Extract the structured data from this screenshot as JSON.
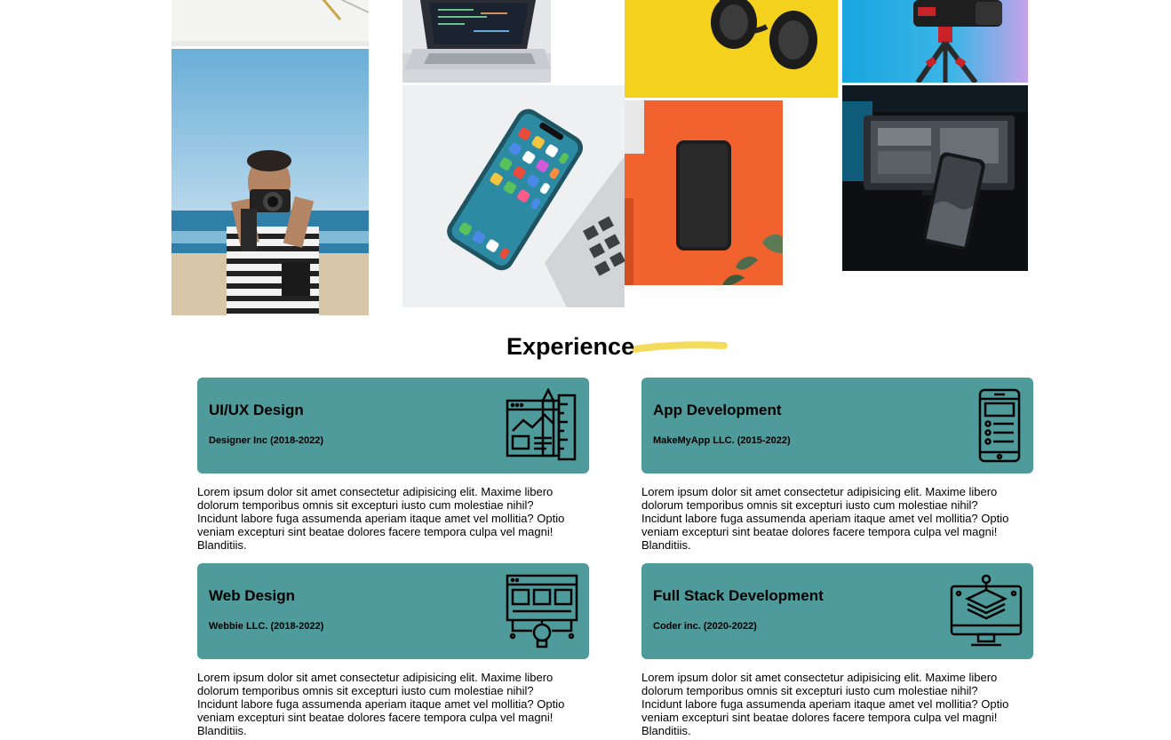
{
  "gallery": {
    "photos": [
      {
        "name": "notebook-pen-photo",
        "icon": "pen-on-paper"
      },
      {
        "name": "photographer-beach-photo",
        "icon": "person-with-camera"
      },
      {
        "name": "laptop-code-photo",
        "icon": "laptop"
      },
      {
        "name": "smartphone-on-laptop-photo",
        "icon": "smartphone"
      },
      {
        "name": "headphones-yellow-photo",
        "icon": "headphones"
      },
      {
        "name": "phone-orange-photo",
        "icon": "smartphone"
      },
      {
        "name": "camera-tripod-photo",
        "icon": "camera"
      },
      {
        "name": "phone-dark-desk-photo",
        "icon": "smartphone"
      }
    ]
  },
  "experience": {
    "title": "Experience",
    "accent_color": "#f3dc5b",
    "card_color": "#4f9a9a",
    "items": [
      {
        "title": "UI/UX Design",
        "company": "Designer Inc (2018-2022)",
        "icon": "design-tools-icon",
        "description": "Lorem ipsum dolor sit amet consectetur adipisicing elit. Maxime libero dolorum temporibus omnis sit excepturi iusto cum molestiae nihil? Incidunt labore fuga assumenda aperiam itaque amet vel mollitia? Optio veniam excepturi sint beatae dolores facere tempora culpa vel magni! Blanditiis."
      },
      {
        "title": "App Development",
        "company": "MakeMyApp LLC. (2015-2022)",
        "icon": "mobile-app-icon",
        "description": "Lorem ipsum dolor sit amet consectetur adipisicing elit. Maxime libero dolorum temporibus omnis sit excepturi iusto cum molestiae nihil? Incidunt labore fuga assumenda aperiam itaque amet vel mollitia? Optio veniam excepturi sint beatae dolores facere tempora culpa vel magni! Blanditiis."
      },
      {
        "title": "Web Design",
        "company": "Webbie LLC. (2018-2022)",
        "icon": "web-design-icon",
        "description": "Lorem ipsum dolor sit amet consectetur adipisicing elit. Maxime libero dolorum temporibus omnis sit excepturi iusto cum molestiae nihil? Incidunt labore fuga assumenda aperiam itaque amet vel mollitia? Optio veniam excepturi sint beatae dolores facere tempora culpa vel magni! Blanditiis."
      },
      {
        "title": "Full Stack Development",
        "company": "Coder inc. (2020-2022)",
        "icon": "full-stack-icon",
        "description": "Lorem ipsum dolor sit amet consectetur adipisicing elit. Maxime libero dolorum temporibus omnis sit excepturi iusto cum molestiae nihil? Incidunt labore fuga assumenda aperiam itaque amet vel mollitia? Optio veniam excepturi sint beatae dolores facere tempora culpa vel magni! Blanditiis."
      }
    ]
  }
}
